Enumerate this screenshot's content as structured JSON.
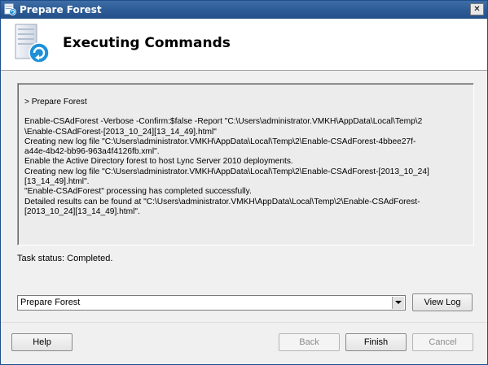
{
  "window": {
    "title": "Prepare Forest",
    "close_glyph": "✕"
  },
  "header": {
    "heading": "Executing Commands"
  },
  "output": {
    "lines": [
      "> Prepare Forest",
      "",
      "Enable-CSAdForest  -Verbose -Confirm:$false -Report \"C:\\Users\\administrator.VMKH\\AppData\\Local\\Temp\\2",
      "\\Enable-CSAdForest-[2013_10_24][13_14_49].html\"",
      "Creating new log file \"C:\\Users\\administrator.VMKH\\AppData\\Local\\Temp\\2\\Enable-CSAdForest-4bbee27f-",
      "a44e-4b42-bb96-963a4f4126fb.xml\".",
      "Enable the Active Directory forest to host Lync Server 2010 deployments.",
      "Creating new log file \"C:\\Users\\administrator.VMKH\\AppData\\Local\\Temp\\2\\Enable-CSAdForest-[2013_10_24]",
      "[13_14_49].html\".",
      "\"Enable-CSAdForest\" processing has completed successfully.",
      "Detailed results can be found at \"C:\\Users\\administrator.VMKH\\AppData\\Local\\Temp\\2\\Enable-CSAdForest-",
      "[2013_10_24][13_14_49].html\"."
    ]
  },
  "status": {
    "text": "Task status: Completed."
  },
  "log_selector": {
    "selected": "Prepare Forest",
    "view_log_label": "View Log"
  },
  "buttons": {
    "help": "Help",
    "back": "Back",
    "finish": "Finish",
    "cancel": "Cancel"
  },
  "icons": {
    "app": "setup-wizard-icon",
    "header": "server-refresh-icon"
  },
  "colors": {
    "titlebar": "#2d5c96",
    "accent_blue": "#1e90d8"
  }
}
